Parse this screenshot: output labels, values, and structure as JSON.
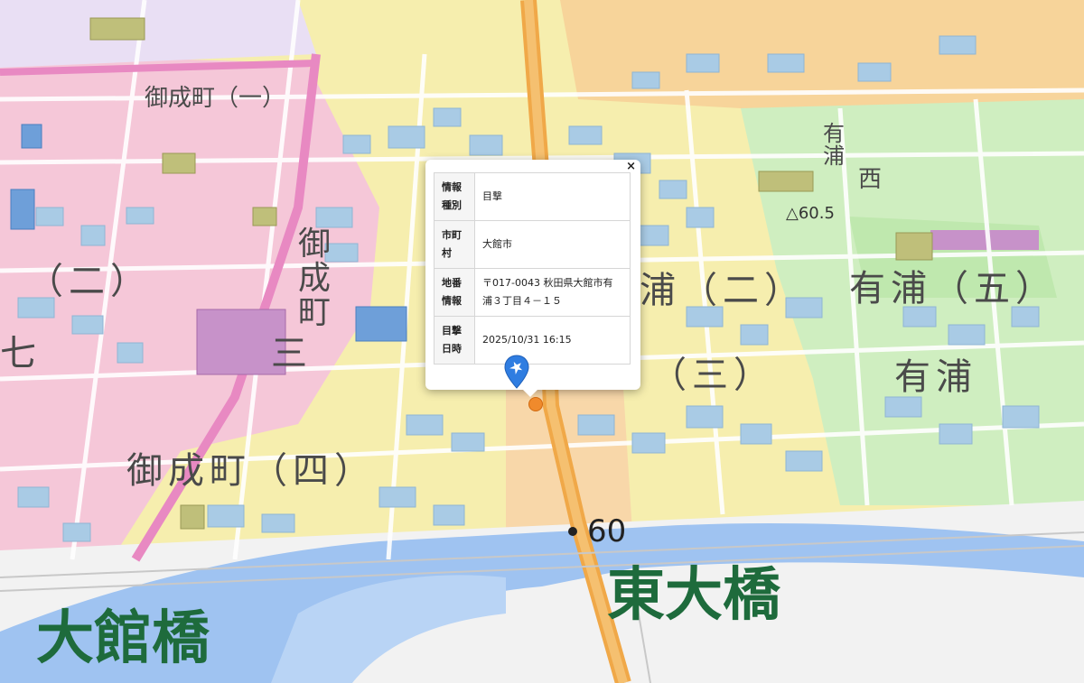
{
  "map": {
    "labels": {
      "oodate_bridge": "大館橋",
      "higashi_bridge": "東大橋",
      "onarimachi4": "御成町（四）",
      "ariura5": "有浦（五）",
      "ariura_mid": "有浦",
      "ariura2": "浦（二）",
      "ariura3": "（三）",
      "onarimachi_v": "御成町",
      "onarimachi1": "御成町（一）",
      "ariura_v": "有浦",
      "nishi": "西",
      "spot_height": "△60.5",
      "route60": "60",
      "paren2_left": "（二）",
      "kan3": "三",
      "kan1_left": "七"
    },
    "colors": {
      "residential_yellow": "#f6eeae",
      "commercial_pink": "#f5c0df",
      "green_zone": "#cfeec0",
      "orange_zone": "#f7d49a",
      "river": "#9fc3f1",
      "building": "#a9cbe5",
      "main_road": "#f5b860"
    }
  },
  "popup": {
    "close_label": "×",
    "rows": [
      {
        "key": "情報種別",
        "value": "目撃"
      },
      {
        "key": "市町村",
        "value": "大館市"
      },
      {
        "key": "地番情報",
        "value": "〒017-0043 秋田県大館市有浦３丁目４－１５"
      },
      {
        "key": "目撃日時",
        "value": "2025/10/31 16:15"
      }
    ]
  },
  "marker": {
    "icon": "bear-sighting-pin-icon",
    "color": "#2f7de1"
  }
}
